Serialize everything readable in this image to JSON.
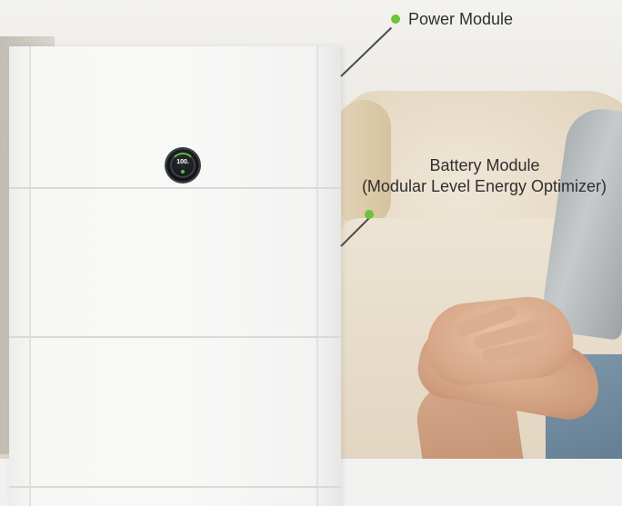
{
  "callouts": {
    "power_module": {
      "label": "Power Module"
    },
    "battery_module": {
      "line1": "Battery Module",
      "line2": "(Modular Level Energy Optimizer)"
    }
  },
  "display": {
    "reading": "100."
  },
  "colors": {
    "accent_green": "#6cc23b",
    "leader_line": "#4a4a4a",
    "label_text": "#2f2f2f"
  }
}
